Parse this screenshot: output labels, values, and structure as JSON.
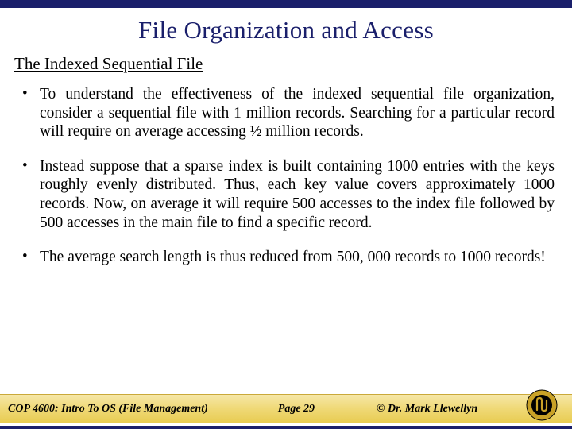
{
  "title": "File Organization and Access",
  "subtitle": "The Indexed Sequential File",
  "bullets": [
    "To understand the effectiveness of the indexed sequential file organization, consider a sequential file with 1 million records.  Searching for a particular record will require on average accessing ½ million records.",
    "Instead suppose that a sparse index is built containing 1000 entries with the keys roughly evenly distributed.  Thus, each key value covers approximately 1000 records.  Now, on average it will require 500 accesses to the index file followed by 500 accesses in the main file to find a specific record.",
    "The average search length is thus reduced from 500, 000 records to 1000 records!"
  ],
  "footer": {
    "course": "COP 4600: Intro To OS  (File Management)",
    "page": "Page 29",
    "author": "© Dr. Mark Llewellyn"
  }
}
